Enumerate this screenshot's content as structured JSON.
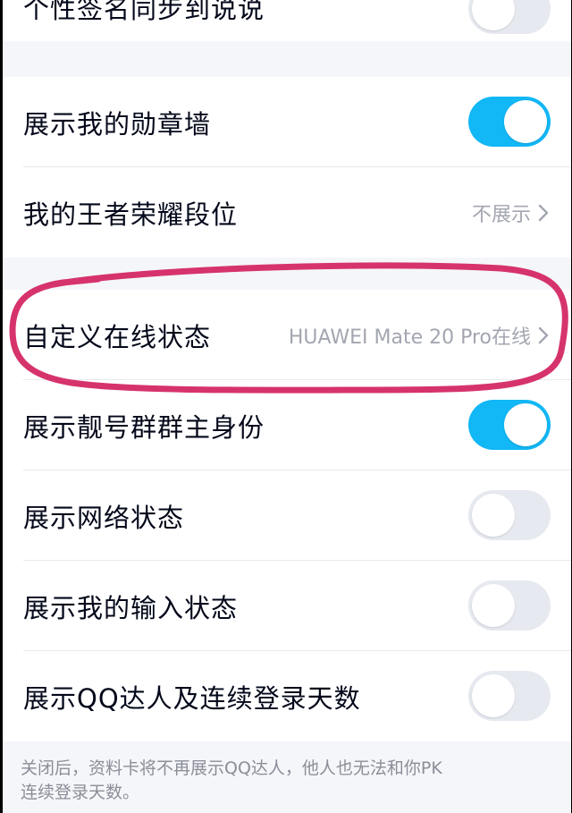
{
  "colors": {
    "accent": "#12b7f5",
    "toggle_off": "#e7e9f0",
    "annotation": "#d6336c",
    "background": "#f5f6fa"
  },
  "rows": {
    "partial_top": {
      "label": "个性签名同步到说说",
      "toggle": "off"
    },
    "badge_wall": {
      "label": "展示我的勋章墙",
      "toggle": "on"
    },
    "king_rank": {
      "label": "我的王者荣耀段位",
      "value": "不展示",
      "icon": "chevron-right-icon"
    },
    "custom_status": {
      "label": "自定义在线状态",
      "value": "HUAWEI Mate 20 Pro在线",
      "icon": "chevron-right-icon"
    },
    "group_owner": {
      "label": "展示靓号群群主身份",
      "toggle": "on"
    },
    "network_status": {
      "label": "展示网络状态",
      "toggle": "off"
    },
    "input_status": {
      "label": "展示我的输入状态",
      "toggle": "off"
    },
    "qq_expert": {
      "label": "展示QQ达人及连续登录天数",
      "toggle": "off"
    }
  },
  "footer": {
    "note_line1": "关闭后，资料卡将不再展示QQ达人，他人也无法和你PK",
    "note_line2": "连续登录天数。"
  }
}
